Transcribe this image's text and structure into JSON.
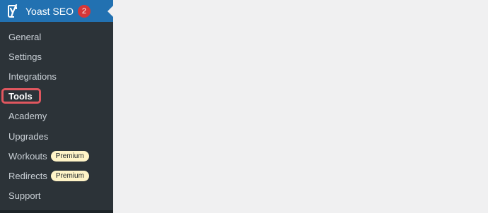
{
  "colors": {
    "header_bg": "#2271b1",
    "sidebar_bg": "#2c3338",
    "content_bg": "#f0f0f1",
    "badge_red": "#d63638",
    "premium_bg": "#fff4c7",
    "highlight_border": "#e0575f"
  },
  "menu": {
    "icon": "yoast-icon",
    "title": "Yoast SEO",
    "count": "2"
  },
  "submenu": {
    "items": [
      {
        "label": "General"
      },
      {
        "label": "Settings"
      },
      {
        "label": "Integrations"
      },
      {
        "label": "Tools",
        "current": true,
        "highlighted": true
      },
      {
        "label": "Academy"
      },
      {
        "label": "Upgrades"
      },
      {
        "label": "Workouts",
        "badge": "Premium"
      },
      {
        "label": "Redirects",
        "badge": "Premium"
      },
      {
        "label": "Support"
      }
    ]
  }
}
